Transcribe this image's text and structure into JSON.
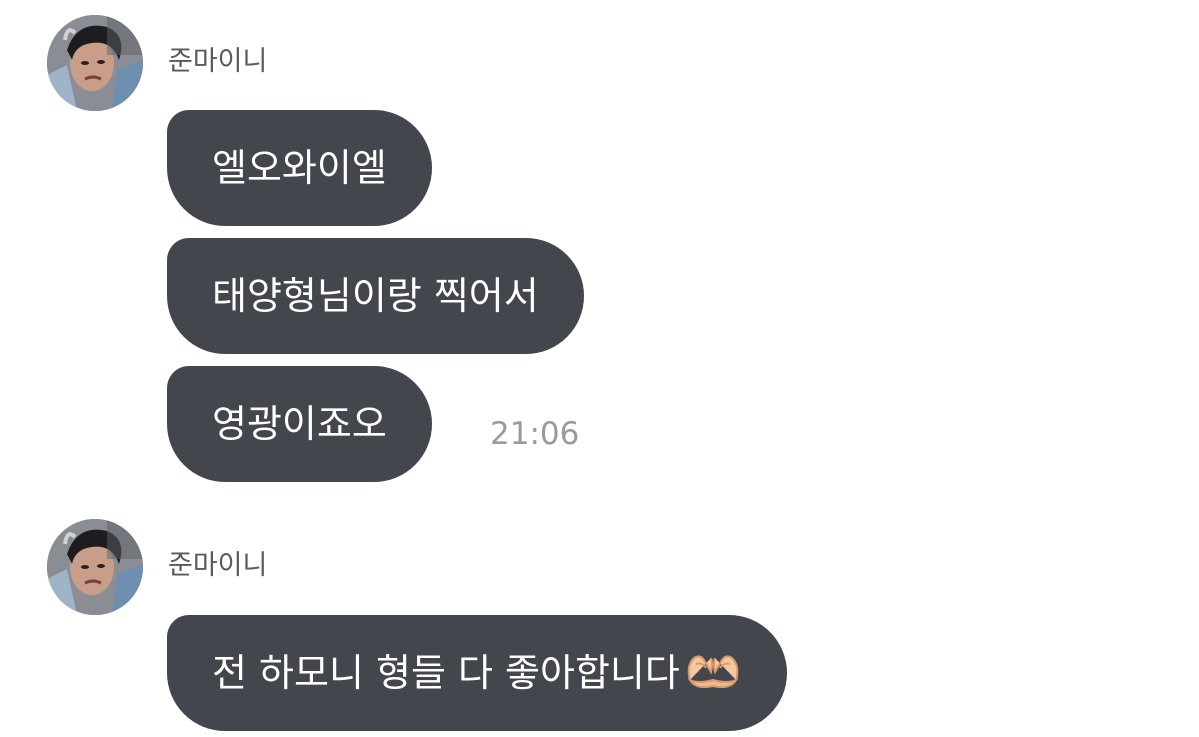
{
  "messages": [
    {
      "sender": "준마이니",
      "avatar_icon": "profile-photo",
      "bubbles": [
        {
          "text": "엘오와이엘"
        },
        {
          "text": "태양형님이랑 찍어서"
        },
        {
          "text": "영광이죠오"
        }
      ],
      "time": "21:06"
    },
    {
      "sender": "준마이니",
      "avatar_icon": "profile-photo",
      "bubbles": [
        {
          "text": "전 하모니 형들 다 좋아합니다",
          "emoji": "heart-hands-icon"
        }
      ]
    }
  ],
  "colors": {
    "bubble_bg": "#44464d",
    "bubble_text": "#ffffff",
    "sender_text": "#5a5a5a",
    "time_text": "#9a9a9a"
  }
}
